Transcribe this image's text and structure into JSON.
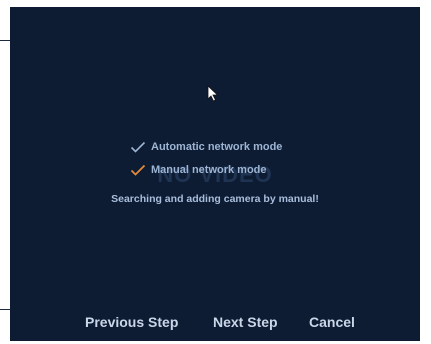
{
  "watermark": "NO VIDEO",
  "options": [
    {
      "label": "Automatic network mode",
      "check_icon": "check-icon",
      "check_color": "#9db4d3"
    },
    {
      "label": "Manual network mode",
      "check_icon": "check-icon",
      "check_color": "#e58a3a"
    }
  ],
  "status_message": "Searching and adding camera by manual!",
  "buttons": {
    "previous_label": "Previous Step",
    "next_label": "Next Step",
    "cancel_label": "Cancel"
  },
  "colors": {
    "background": "#0d1c33",
    "text": "#9db4d3",
    "button_text": "#c9d6e8",
    "accent_check": "#e58a3a"
  }
}
